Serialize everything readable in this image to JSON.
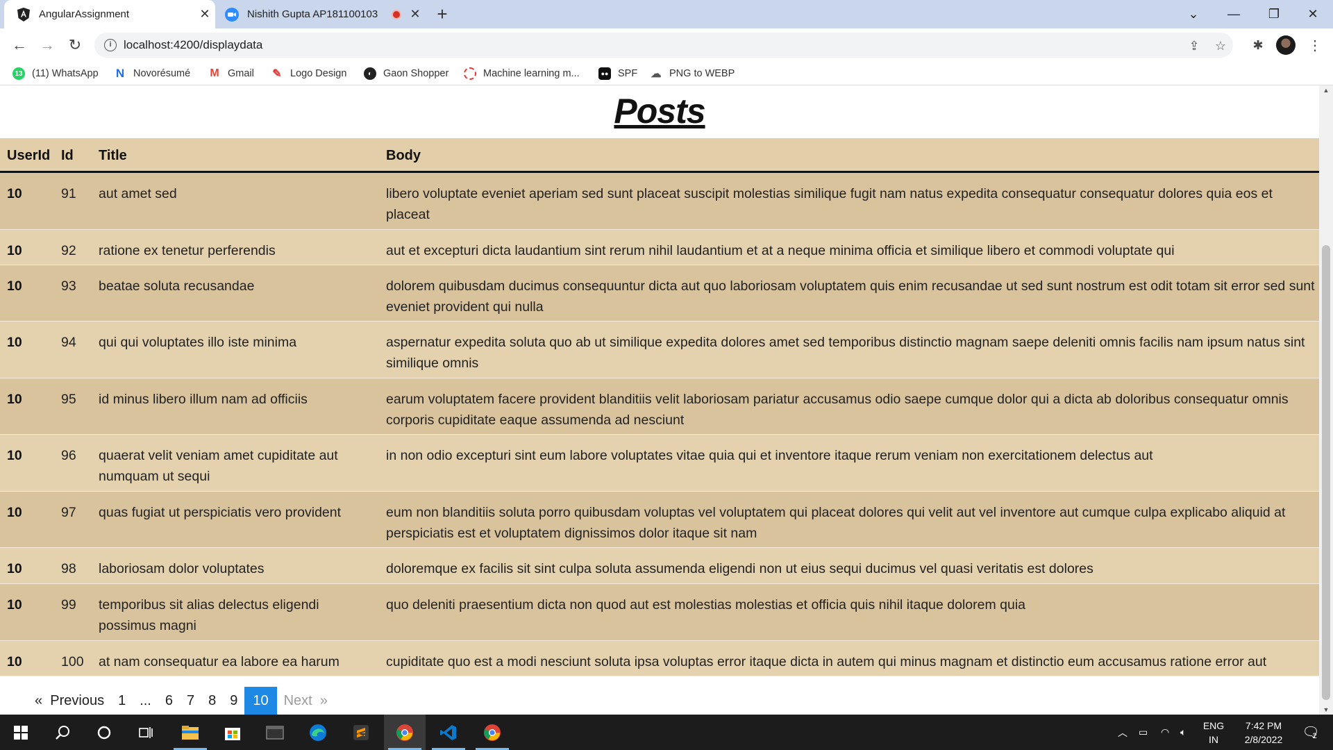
{
  "browser": {
    "tabs": [
      {
        "title": "AngularAssignment",
        "favicon": "angular-icon"
      },
      {
        "title": "Nishith Gupta AP181100103",
        "favicon": "zoom-icon"
      }
    ],
    "url": "localhost:4200/displaydata",
    "bookmarks": [
      {
        "label": "(11) WhatsApp",
        "icon": "whatsapp-icon",
        "badge": "13"
      },
      {
        "label": "Novorésumé",
        "icon": "novoresume-icon",
        "letter": "N"
      },
      {
        "label": "Gmail",
        "icon": "gmail-icon",
        "letter": "M"
      },
      {
        "label": "Logo Design",
        "icon": "logo-design-icon"
      },
      {
        "label": "Gaon Shopper",
        "icon": "gaon-shopper-icon"
      },
      {
        "label": "Machine learning m...",
        "icon": "machine-learning-icon"
      },
      {
        "label": "SPF",
        "icon": "spf-icon"
      },
      {
        "label": "PNG to WEBP",
        "icon": "png-to-webp-icon"
      }
    ]
  },
  "page": {
    "title": "Posts",
    "columns": {
      "userid": "UserId",
      "id": "Id",
      "title": "Title",
      "body": "Body"
    },
    "rows": [
      {
        "userId": "10",
        "id": "91",
        "title": "aut amet sed",
        "body": "libero voluptate eveniet aperiam sed sunt placeat suscipit molestias similique fugit nam natus expedita consequatur consequatur dolores quia eos et placeat"
      },
      {
        "userId": "10",
        "id": "92",
        "title": "ratione ex tenetur perferendis",
        "body": "aut et excepturi dicta laudantium sint rerum nihil laudantium et at a neque minima officia et similique libero et commodi voluptate qui"
      },
      {
        "userId": "10",
        "id": "93",
        "title": "beatae soluta recusandae",
        "body": "dolorem quibusdam ducimus consequuntur dicta aut quo laboriosam voluptatem quis enim recusandae ut sed sunt nostrum est odit totam sit error sed sunt eveniet provident qui nulla"
      },
      {
        "userId": "10",
        "id": "94",
        "title": "qui qui voluptates illo iste minima",
        "body": "aspernatur expedita soluta quo ab ut similique expedita dolores amet sed temporibus distinctio magnam saepe deleniti omnis facilis nam ipsum natus sint similique omnis"
      },
      {
        "userId": "10",
        "id": "95",
        "title": "id minus libero illum nam ad officiis",
        "body": "earum voluptatem facere provident blanditiis velit laboriosam pariatur accusamus odio saepe cumque dolor qui a dicta ab doloribus consequatur omnis corporis cupiditate eaque assumenda ad nesciunt"
      },
      {
        "userId": "10",
        "id": "96",
        "title": "quaerat velit veniam amet cupiditate aut numquam ut sequi",
        "body": "in non odio excepturi sint eum labore voluptates vitae quia qui et inventore itaque rerum veniam non exercitationem delectus aut"
      },
      {
        "userId": "10",
        "id": "97",
        "title": "quas fugiat ut perspiciatis vero provident",
        "body": "eum non blanditiis soluta porro quibusdam voluptas vel voluptatem qui placeat dolores qui velit aut vel inventore aut cumque culpa explicabo aliquid at perspiciatis est et voluptatem dignissimos dolor itaque sit nam"
      },
      {
        "userId": "10",
        "id": "98",
        "title": "laboriosam dolor voluptates",
        "body": "doloremque ex facilis sit sint culpa soluta assumenda eligendi non ut eius sequi ducimus vel quasi veritatis est dolores"
      },
      {
        "userId": "10",
        "id": "99",
        "title": "temporibus sit alias delectus eligendi possimus magni",
        "body": "quo deleniti praesentium dicta non quod aut est molestias molestias et officia quis nihil itaque dolorem quia"
      },
      {
        "userId": "10",
        "id": "100",
        "title": "at nam consequatur ea labore ea harum",
        "body": "cupiditate quo est a modi nesciunt soluta ipsa voluptas error itaque dicta in autem qui minus magnam et distinctio eum accusamus ratione error aut"
      }
    ],
    "pagination": {
      "prev_arrow": "«",
      "previous": "Previous",
      "pages": [
        "1",
        "...",
        "6",
        "7",
        "8",
        "9",
        "10"
      ],
      "current": "10",
      "next": "Next",
      "next_arrow": "»"
    },
    "colors": {
      "header_bg": "#e2cfa9",
      "row_odd": "#d9c39d",
      "row_even": "#e4d1ae",
      "pager_active": "#1e88e5"
    }
  },
  "taskbar": {
    "language": "ENG",
    "region": "IN",
    "time": "7:42 PM",
    "date": "2/8/2022",
    "notification_count": "2"
  }
}
